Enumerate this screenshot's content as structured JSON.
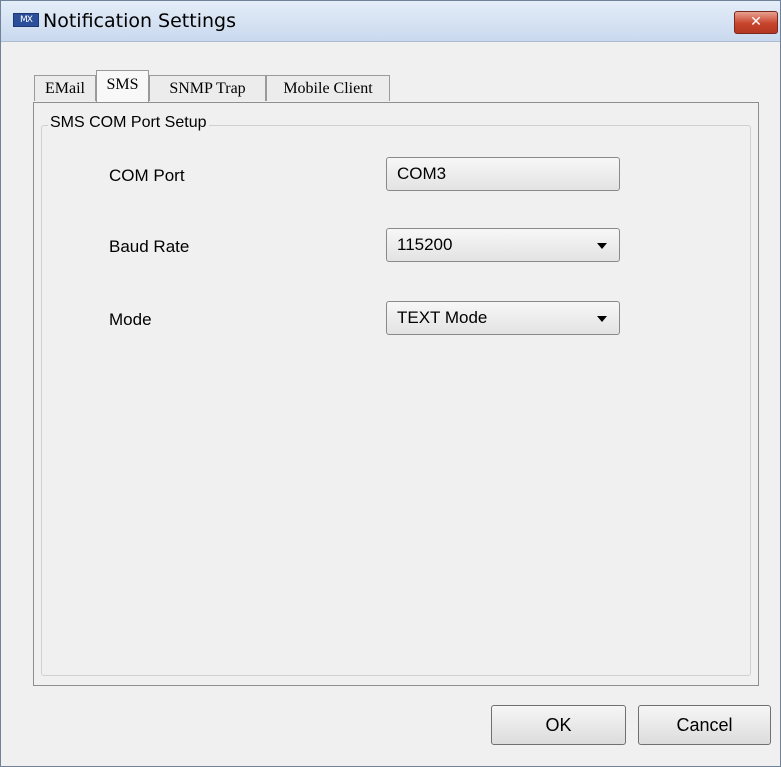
{
  "window": {
    "title": "Notification Settings",
    "icon": "app-icon",
    "close_label": "✕"
  },
  "tabs": [
    {
      "label": "EMail",
      "active": false
    },
    {
      "label": "SMS",
      "active": true
    },
    {
      "label": "SNMP Trap",
      "active": false
    },
    {
      "label": "Mobile Client",
      "active": false
    }
  ],
  "group": {
    "title": "SMS COM Port Setup",
    "fields": [
      {
        "label": "COM Port",
        "value": "COM3",
        "type": "button"
      },
      {
        "label": "Baud Rate",
        "value": "115200",
        "type": "select"
      },
      {
        "label": "Mode",
        "value": "TEXT Mode",
        "type": "select"
      }
    ]
  },
  "buttons": {
    "ok": "OK",
    "cancel": "Cancel"
  }
}
